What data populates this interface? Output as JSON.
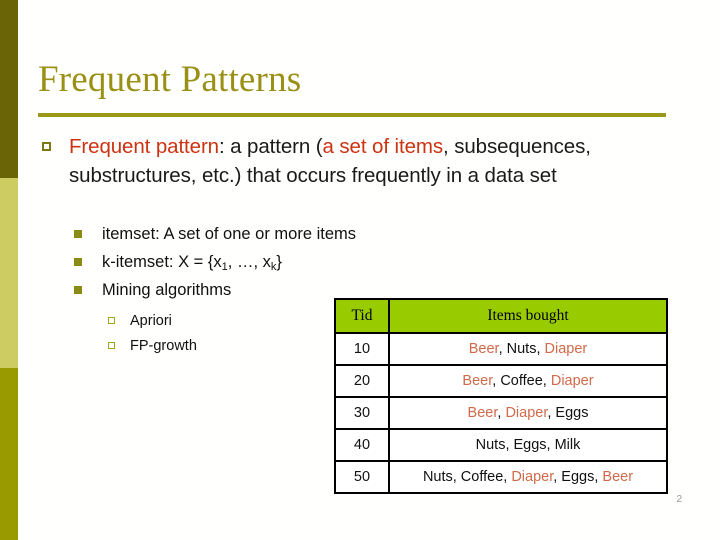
{
  "slide": {
    "title": "Frequent Patterns",
    "page_number": "2"
  },
  "colors": {
    "title": "#9a9015",
    "rule": "#9a9918",
    "stripe_top": "#6b6406",
    "stripe_mid": "#cccc63",
    "stripe_bottom": "#999900",
    "highlight_red": "#cc3311",
    "table_header_bg": "#99cc00",
    "item_highlight": "#d06a4a"
  },
  "body": {
    "bullet_level1": {
      "marker": "hollow-square",
      "segments": [
        {
          "text": "Frequent pattern",
          "style": "highlight"
        },
        {
          "text": ": a pattern (",
          "style": "normal"
        },
        {
          "text": "a set of items",
          "style": "highlight"
        },
        {
          "text": ", subsequences, substructures, etc.) that occurs frequently in a data set",
          "style": "normal"
        }
      ],
      "plain_text": "Frequent pattern: a pattern (a set of items, subsequences, substructures, etc.) that occurs frequently in a data set"
    },
    "bullets_level2": [
      {
        "text": "itemset: A set of one or more items",
        "marker": "filled-square"
      },
      {
        "text": "k-itemset: X = {x1, …, xk}",
        "marker": "filled-square",
        "has_subscripts": true
      },
      {
        "text": "Mining algorithms",
        "marker": "filled-square"
      }
    ],
    "bullets_level3": [
      {
        "text": "Apriori",
        "marker": "hollow-square"
      },
      {
        "text": "FP-growth",
        "marker": "hollow-square"
      }
    ]
  },
  "transaction_table": {
    "headers": [
      "Tid",
      "Items bought"
    ],
    "rows": [
      {
        "tid": "10",
        "items_plain": "Beer, Nuts, Diaper",
        "items": [
          {
            "text": "Beer",
            "style": "highlight"
          },
          {
            "text": ", Nuts, ",
            "style": "normal"
          },
          {
            "text": "Diaper",
            "style": "highlight"
          }
        ]
      },
      {
        "tid": "20",
        "items_plain": "Beer, Coffee, Diaper",
        "items": [
          {
            "text": "Beer",
            "style": "highlight"
          },
          {
            "text": ", Coffee, ",
            "style": "normal"
          },
          {
            "text": "Diaper",
            "style": "highlight"
          }
        ]
      },
      {
        "tid": "30",
        "items_plain": "Beer, Diaper, Eggs",
        "items": [
          {
            "text": "Beer",
            "style": "highlight"
          },
          {
            "text": ", ",
            "style": "normal"
          },
          {
            "text": "Diaper",
            "style": "highlight"
          },
          {
            "text": ", Eggs",
            "style": "normal"
          }
        ]
      },
      {
        "tid": "40",
        "items_plain": "Nuts, Eggs, Milk",
        "items": [
          {
            "text": "Nuts, Eggs, Milk",
            "style": "normal"
          }
        ]
      },
      {
        "tid": "50",
        "items_plain": "Nuts, Coffee, Diaper, Eggs, Beer",
        "items": [
          {
            "text": "Nuts, Coffee, ",
            "style": "normal"
          },
          {
            "text": "Diaper",
            "style": "highlight"
          },
          {
            "text": ", Eggs, ",
            "style": "normal"
          },
          {
            "text": "Beer",
            "style": "highlight"
          }
        ]
      }
    ]
  }
}
